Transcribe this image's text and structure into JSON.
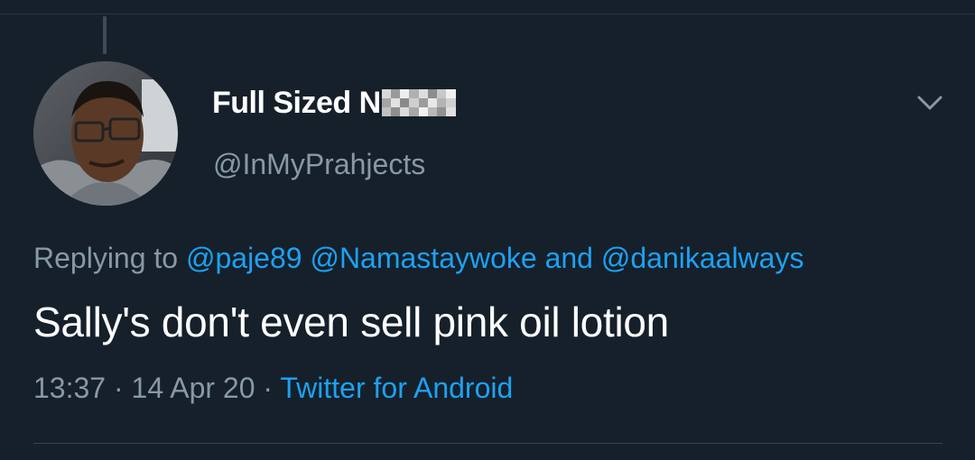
{
  "tweet": {
    "display_name": "Full Sized N",
    "handle": "@InMyPrahjects",
    "reply": {
      "prefix": "Replying to",
      "mention_1": "@paje89",
      "mention_2": "@Namastaywoke",
      "conjunction": "and",
      "mention_3": "@danikaalways"
    },
    "text": "Sally's don't even sell pink oil lotion",
    "meta": {
      "time": "13:37",
      "separator": "·",
      "date": "14 Apr 20",
      "source": "Twitter for Android"
    }
  },
  "icons": {
    "menu": "chevron-down-icon",
    "avatar": "avatar"
  },
  "colors": {
    "background": "#15202b",
    "primary_text": "#ffffff",
    "secondary_text": "#8899a6",
    "link": "#1da1f2",
    "divider": "#38444d"
  }
}
